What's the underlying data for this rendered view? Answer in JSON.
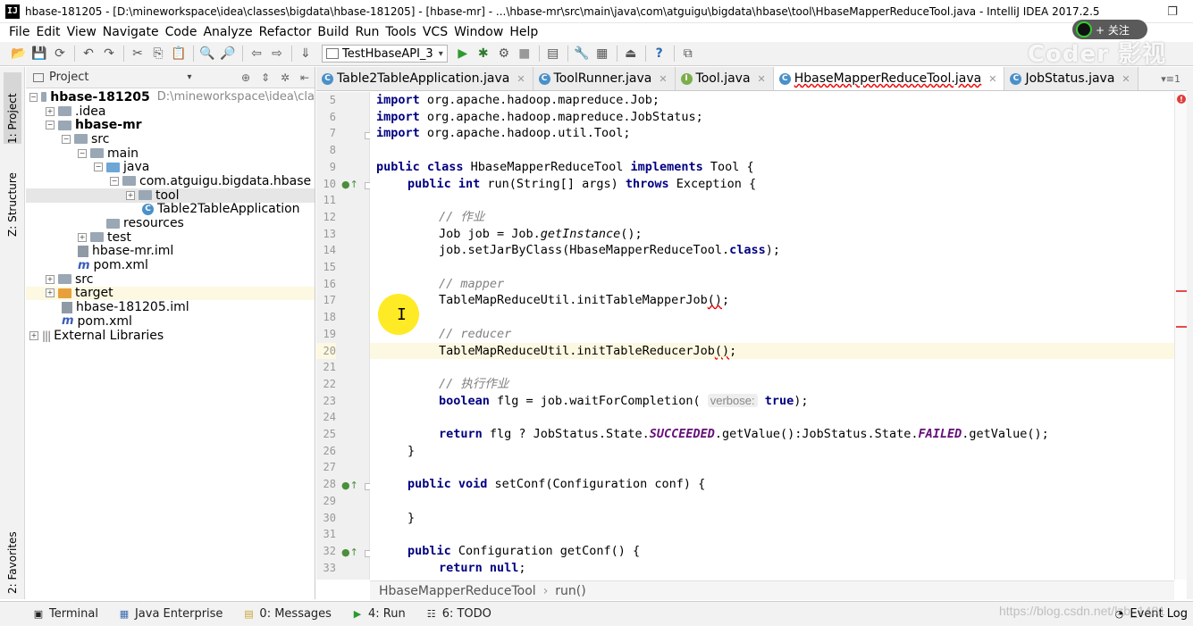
{
  "window": {
    "title": "hbase-181205 - [D:\\mineworkspace\\idea\\classes\\bigdata\\hbase-181205] - [hbase-mr] - ...\\hbase-mr\\src\\main\\java\\com\\atguigu\\bigdata\\hbase\\tool\\HbaseMapperReduceTool.java - IntelliJ IDEA 2017.2.5",
    "app_icon": "IJ",
    "restore_glyph": "❐",
    "follow_label": "+ 关注",
    "watermark_top": "Coder 影视"
  },
  "menu": [
    "File",
    "Edit",
    "View",
    "Navigate",
    "Code",
    "Analyze",
    "Refactor",
    "Build",
    "Run",
    "Tools",
    "VCS",
    "Window",
    "Help"
  ],
  "toolbar": {
    "run_config": "TestHbaseAPI_3",
    "run_config_arrow": "▾"
  },
  "left_stripe": {
    "project": "1: Project",
    "structure": "Z: Structure",
    "favorites": "2: Favorites"
  },
  "project_panel": {
    "title": "Project",
    "title_arrow": "▾",
    "tree": [
      {
        "label": "hbase-181205",
        "hint": "D:\\mineworkspace\\idea\\cla",
        "bold": true,
        "depth": 0
      },
      {
        "label": ".idea",
        "depth": 1
      },
      {
        "label": "hbase-mr",
        "bold": true,
        "depth": 1
      },
      {
        "label": "src",
        "depth": 2
      },
      {
        "label": "main",
        "depth": 3
      },
      {
        "label": "java",
        "depth": 4
      },
      {
        "label": "com.atguigu.bigdata.hbase",
        "depth": 5
      },
      {
        "label": "tool",
        "depth": 6
      },
      {
        "label": "Table2TableApplication",
        "depth": 6
      },
      {
        "label": "resources",
        "depth": 4
      },
      {
        "label": "test",
        "depth": 3
      },
      {
        "label": "hbase-mr.iml",
        "depth": 2
      },
      {
        "label": "pom.xml",
        "depth": 2
      },
      {
        "label": "src",
        "depth": 1
      },
      {
        "label": "target",
        "depth": 1
      },
      {
        "label": "hbase-181205.iml",
        "depth": 1
      },
      {
        "label": "pom.xml",
        "depth": 1
      },
      {
        "label": "External Libraries",
        "depth": 0
      }
    ]
  },
  "editor_tabs": [
    {
      "label": "Table2TableApplication.java",
      "icon": "C",
      "active": false
    },
    {
      "label": "ToolRunner.java",
      "icon": "C",
      "active": false
    },
    {
      "label": "Tool.java",
      "icon": "I",
      "active": false
    },
    {
      "label": "HbaseMapperReduceTool.java",
      "icon": "C",
      "active": true
    },
    {
      "label": "JobStatus.java",
      "icon": "C",
      "active": false
    }
  ],
  "tabs_extra": "▾≡1",
  "code": {
    "line_numbers": [
      "5",
      "6",
      "7",
      "8",
      "9",
      "10",
      "11",
      "12",
      "13",
      "14",
      "15",
      "16",
      "17",
      "18",
      "19",
      "20",
      "21",
      "22",
      "23",
      "24",
      "25",
      "26",
      "27",
      "28",
      "29",
      "30",
      "31",
      "32",
      "33"
    ],
    "lines": {
      "l5_kw": "import",
      "l5_rest": " org.apache.hadoop.mapreduce.Job;",
      "l6_kw": "import",
      "l6_rest": " org.apache.hadoop.mapreduce.JobStatus;",
      "l7_kw": "import",
      "l7_rest": " org.apache.hadoop.util.Tool;",
      "l9_kw1": "public class",
      "l9_a": " HbaseMapperReduceTool ",
      "l9_kw2": "implements",
      "l9_b": " Tool {",
      "l10_kw1": "public int",
      "l10_a": " run(String[] args) ",
      "l10_kw2": "throws",
      "l10_b": " Exception {",
      "l12_cm": "// 作业",
      "l13_a": "Job job = Job.",
      "l13_mi": "getInstance",
      "l13_b": "();",
      "l14_a": "job.setJarByClass(HbaseMapperReduceTool.",
      "l14_kw": "class",
      "l14_b": ");",
      "l16_cm": "// mapper",
      "l17_a": "TableMapReduceUtil.initTableMapperJob",
      "l17_sq": "()",
      "l17_b": ";",
      "l19_cm": "// reducer",
      "l20_a": "TableMapReduceUtil.initTableReducerJob",
      "l20_sq": "()",
      "l20_b": ";",
      "l22_cm": "// 执行作业",
      "l23_kw": "boolean",
      "l23_a": " flg = job.waitForCompletion( ",
      "l23_hint": "verbose:",
      "l23_kw2": "true",
      "l23_b": ");",
      "l25_kw": "return",
      "l25_a": " flg ? JobStatus.State.",
      "l25_st1": "SUCCEEDED",
      "l25_b": ".getValue():JobStatus.State.",
      "l25_st2": "FAILED",
      "l25_c": ".getValue();",
      "l26": "}",
      "l28_kw": "public void",
      "l28_a": " setConf(Configuration conf) {",
      "l30": "}",
      "l32_kw": "public",
      "l32_a": " Configuration getConf() {",
      "l33_kw": "return null",
      "l33_a": ";"
    }
  },
  "breadcrumb": [
    "HbaseMapperReduceTool",
    "run()"
  ],
  "breadcrumb_sep": "›",
  "bottom_bar": [
    {
      "label": "Terminal",
      "icon": "terminal-icon"
    },
    {
      "label": "Java Enterprise",
      "icon": "java-enterprise-icon"
    },
    {
      "label": "0: Messages",
      "icon": "messages-icon"
    },
    {
      "label": "4: Run",
      "icon": "run-icon"
    },
    {
      "label": "6: TODO",
      "icon": "todo-icon"
    }
  ],
  "event_log": "Event Log",
  "watermark_url": "https://blog.csdn.net/lzb_1481"
}
